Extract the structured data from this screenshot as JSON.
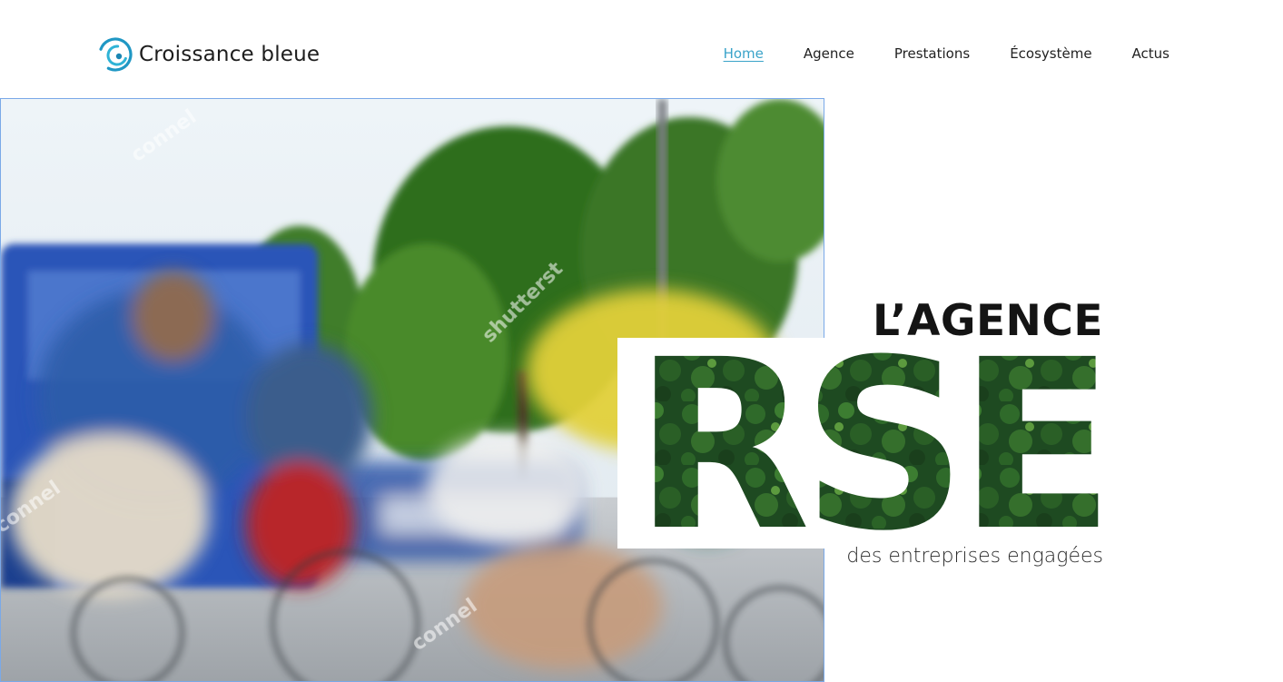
{
  "brand": {
    "name": "Croissance bleue",
    "logo_icon": "swirl-logo-icon",
    "accent_color": "#3aa3c9"
  },
  "nav": {
    "items": [
      {
        "label": "Home",
        "active": true
      },
      {
        "label": "Agence",
        "active": false
      },
      {
        "label": "Prestations",
        "active": false
      },
      {
        "label": "Écosystème",
        "active": false
      },
      {
        "label": "Actus",
        "active": false
      }
    ]
  },
  "hero": {
    "kicker": "L’AGENCE",
    "headline": "RSE",
    "subtitle": "des entreprises engagées",
    "headline_fill": "forest-texture",
    "headline_color": "#1f4a22"
  }
}
